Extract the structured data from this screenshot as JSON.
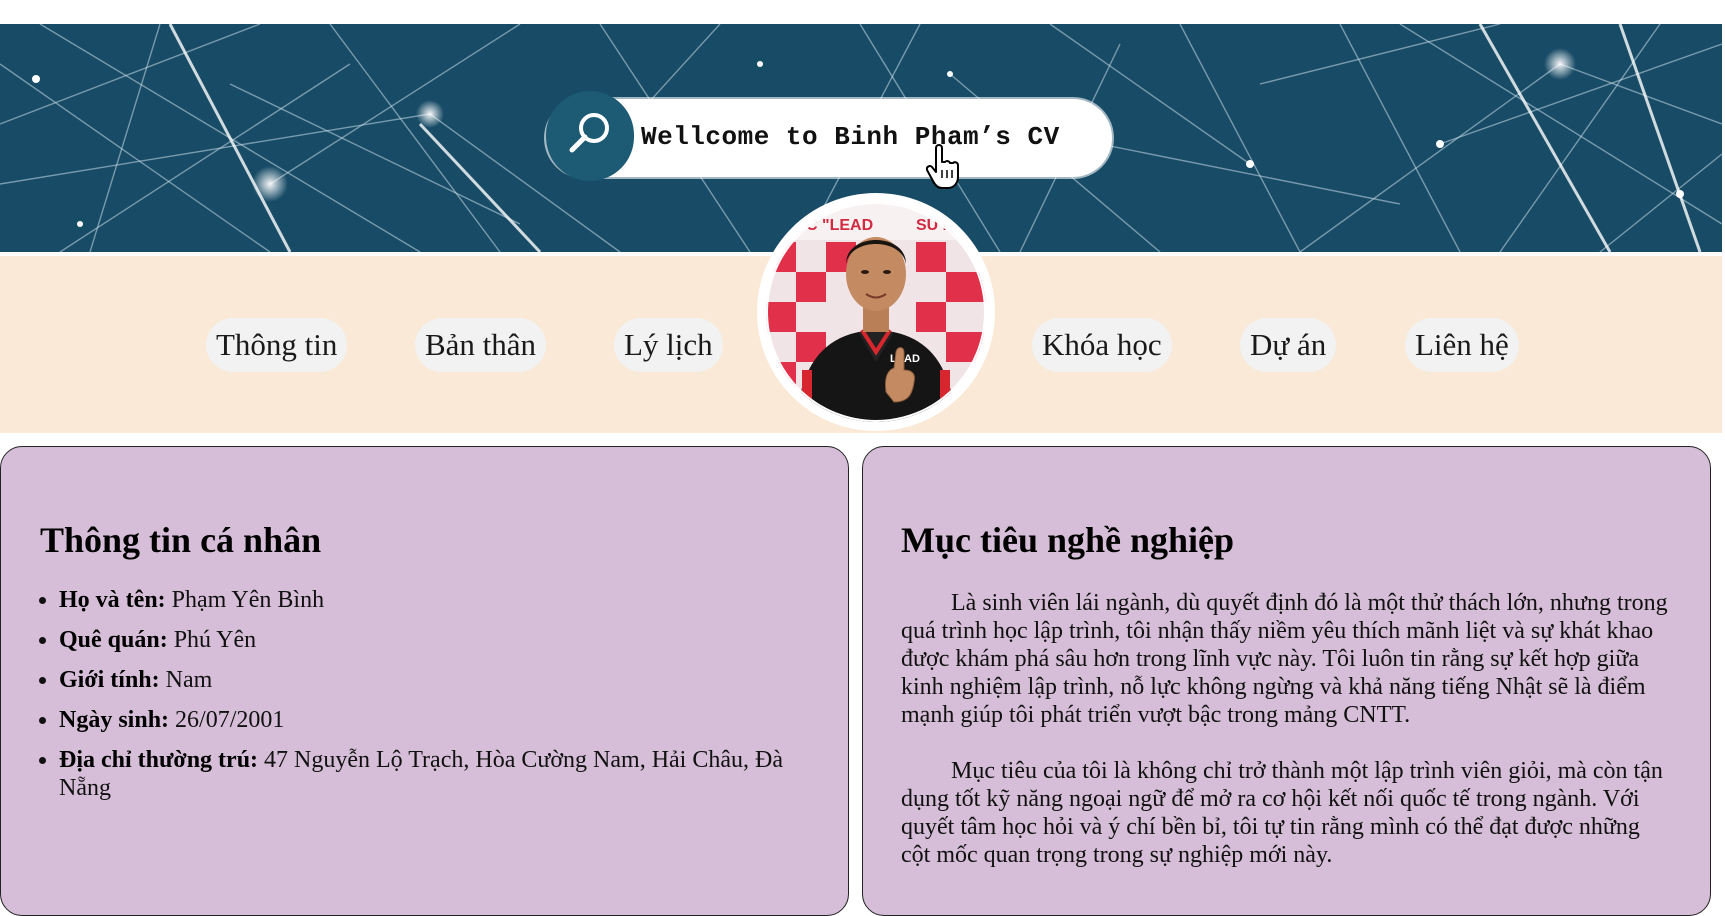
{
  "header": {
    "search_text": "Wellcome to Binh Pham’s CV"
  },
  "nav": {
    "items": [
      "Thông tin",
      "Bản thân",
      "Lý lịch",
      "Khóa học",
      "Dự án",
      "Liên hệ"
    ]
  },
  "avatar": {
    "shirt_text": "LEAD"
  },
  "personal_info": {
    "title": "Thông tin cá nhân",
    "rows": [
      {
        "label": "Họ và tên:",
        "value": "Phạm Yên Bình"
      },
      {
        "label": "Quê quán:",
        "value": "Phú Yên"
      },
      {
        "label": "Giới tính:",
        "value": "Nam"
      },
      {
        "label": "Ngày sinh:",
        "value": "26/07/2001"
      },
      {
        "label": "Địa chỉ thường trú:",
        "value": "47 Nguyễn Lộ Trạch, Hòa Cường Nam, Hải Châu, Đà Nẵng"
      }
    ]
  },
  "career_goal": {
    "title": "Mục tiêu nghề nghiệp",
    "paragraphs": [
      "Là sinh viên lái ngành, dù quyết định đó là một thử thách lớn, nhưng trong quá trình học lập trình, tôi nhận thấy niềm yêu thích mãnh liệt và sự khát khao được khám phá sâu hơn trong lĩnh vực này. Tôi luôn tin rằng sự kết hợp giữa kinh nghiệm lập trình, nỗ lực không ngừng và khả năng tiếng Nhật sẽ là điểm mạnh giúp tôi phát triển vượt bậc trong mảng CNTT.",
      "Mục tiêu của tôi là không chỉ trở thành một lập trình viên giỏi, mà còn tận dụng tốt kỹ năng ngoại ngữ để mở ra cơ hội kết nối quốc tế trong ngành. Với quyết tâm học hỏi và ý chí bền bỉ, tôi tự tin rằng mình có thể đạt được những cột mốc quan trọng trong sự nghiệp mới này."
    ]
  },
  "colors": {
    "banner": "#164a66",
    "nav_band": "#f9e9d6",
    "card": "#d6bed8",
    "nav_pill": "#f2f2f2"
  }
}
